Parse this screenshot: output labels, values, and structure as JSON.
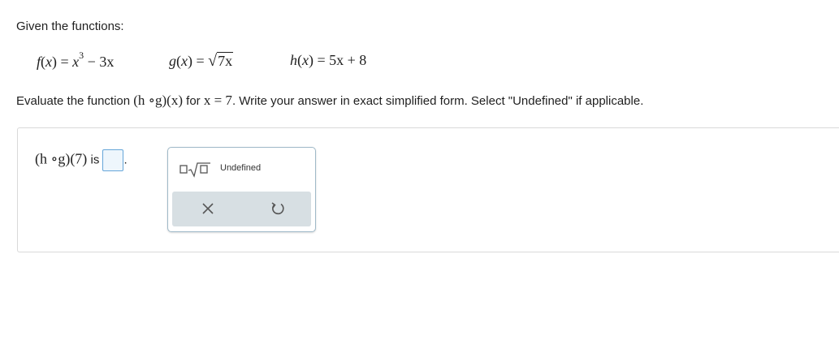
{
  "intro": "Given the functions:",
  "functions": {
    "f": {
      "name": "f",
      "arg": "x",
      "eq": "x",
      "exp": "3",
      "tail": " − 3x"
    },
    "g": {
      "name": "g",
      "arg": "x",
      "radicand": "7x"
    },
    "h": {
      "name": "h",
      "arg": "x",
      "rhs": "5x + 8"
    }
  },
  "instruction": {
    "before": "Evaluate the function ",
    "expr": "(h ∘g)(x)",
    "for_text": " for ",
    "cond": "x = 7",
    "after": ". Write your answer in exact simplified form. Select \"Undefined\" if applicable."
  },
  "answer": {
    "expr": "(h ∘g)(7)",
    "is_label": " is ",
    "period": ".",
    "value": ""
  },
  "keypad": {
    "undefined_label": "Undefined",
    "keys": [
      "sqrt-template-icon",
      "clear-x-icon",
      "undo-icon"
    ]
  }
}
